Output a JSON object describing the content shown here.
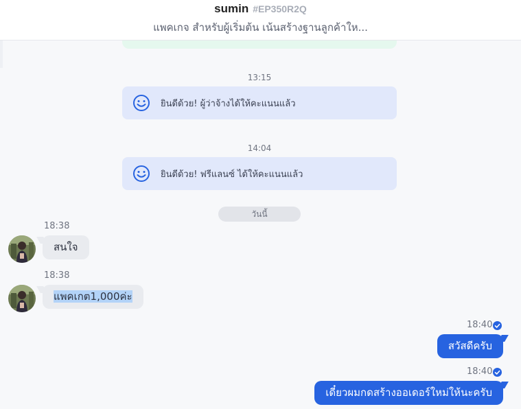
{
  "header": {
    "username": "sumin",
    "code": "#EP350R2Q",
    "subtitle": "แพคเกจ สำหรับผู้เริ่มต้น เน้นสร้างฐานลูกค้าให..."
  },
  "system_messages": [
    {
      "time": "13:15",
      "text": "ยินดีด้วย! ผู้ว่าจ้างได้ให้คะแนนแล้ว",
      "icon": "smiley-icon"
    },
    {
      "time": "14:04",
      "text": "ยินดีด้วย! ฟรีแลนซ์ ได้ให้คะแนนแล้ว",
      "icon": "smiley-icon"
    }
  ],
  "date_divider": "วันนี้",
  "incoming": [
    {
      "time": "18:38",
      "text": "สนใจ"
    },
    {
      "time": "18:38",
      "text": "แพคเกต1,000ค่ะ"
    }
  ],
  "outgoing": [
    {
      "time": "18:40",
      "text": "สวัสดีครับ",
      "status": "read"
    },
    {
      "time": "18:40",
      "text": "เดี๋ยวผมกดสร้างออเดอร์ใหม่ให้นะครับ",
      "status": "read"
    }
  ],
  "colors": {
    "accent": "#2763e0",
    "system_card": "#e1e8fb",
    "incoming_bubble": "#e9ebef",
    "selection": "#b3d3f8"
  }
}
